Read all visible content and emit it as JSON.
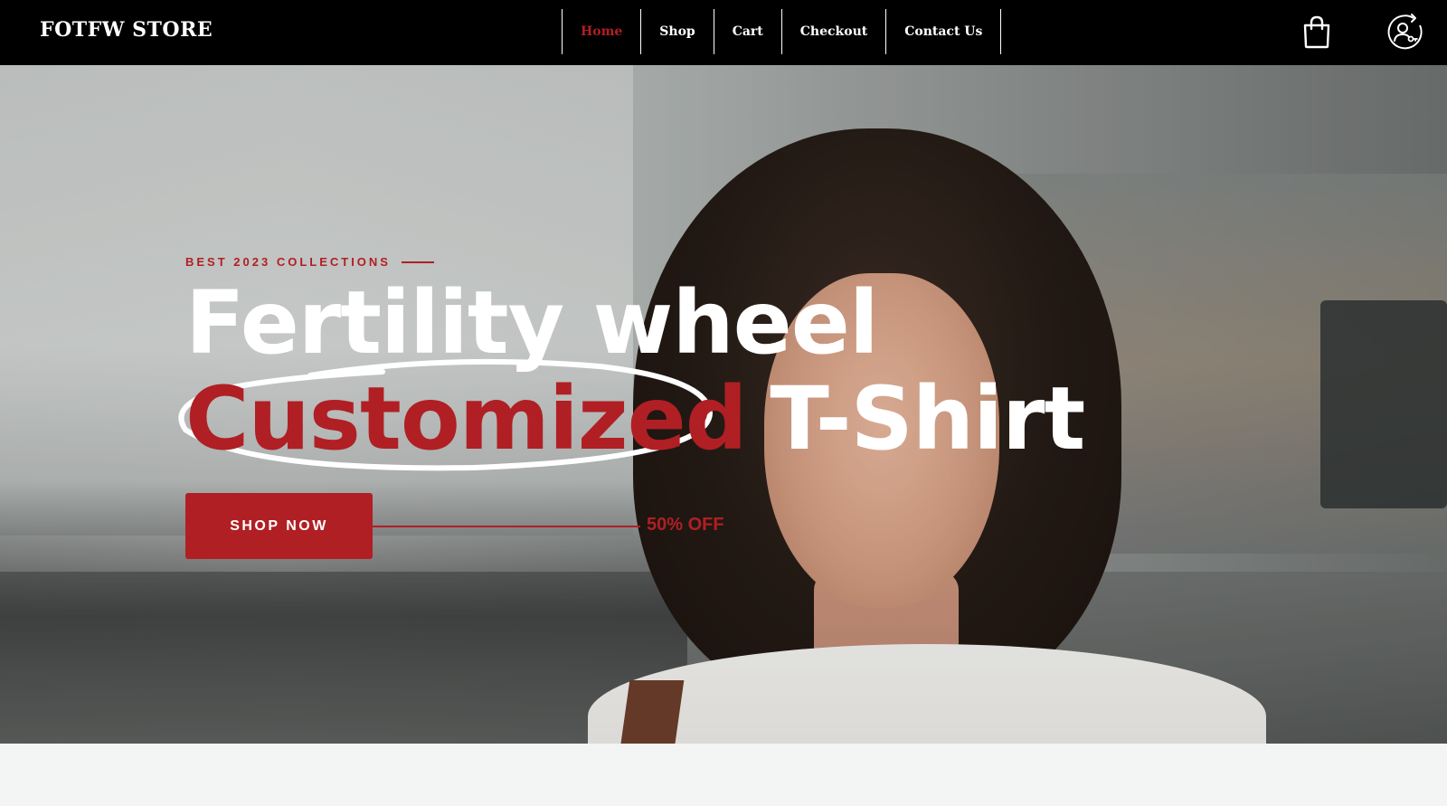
{
  "header": {
    "brand": "FOTFW STORE",
    "nav": [
      {
        "label": "Home",
        "active": true
      },
      {
        "label": "Shop",
        "active": false
      },
      {
        "label": "Cart",
        "active": false
      },
      {
        "label": "Checkout",
        "active": false
      },
      {
        "label": "Contact Us",
        "active": false
      }
    ],
    "icons": [
      "shopping-bag-icon",
      "user-login-icon"
    ],
    "active_color": "#b01f24"
  },
  "hero": {
    "eyebrow": "BEST 2023 COLLECTIONS",
    "title_line1": "Fertility wheel",
    "title_highlight": "Customized",
    "title_rest": "T-Shirt",
    "cta_label": "SHOP NOW",
    "offer": "50% OFF",
    "accent_color": "#b01f24"
  }
}
